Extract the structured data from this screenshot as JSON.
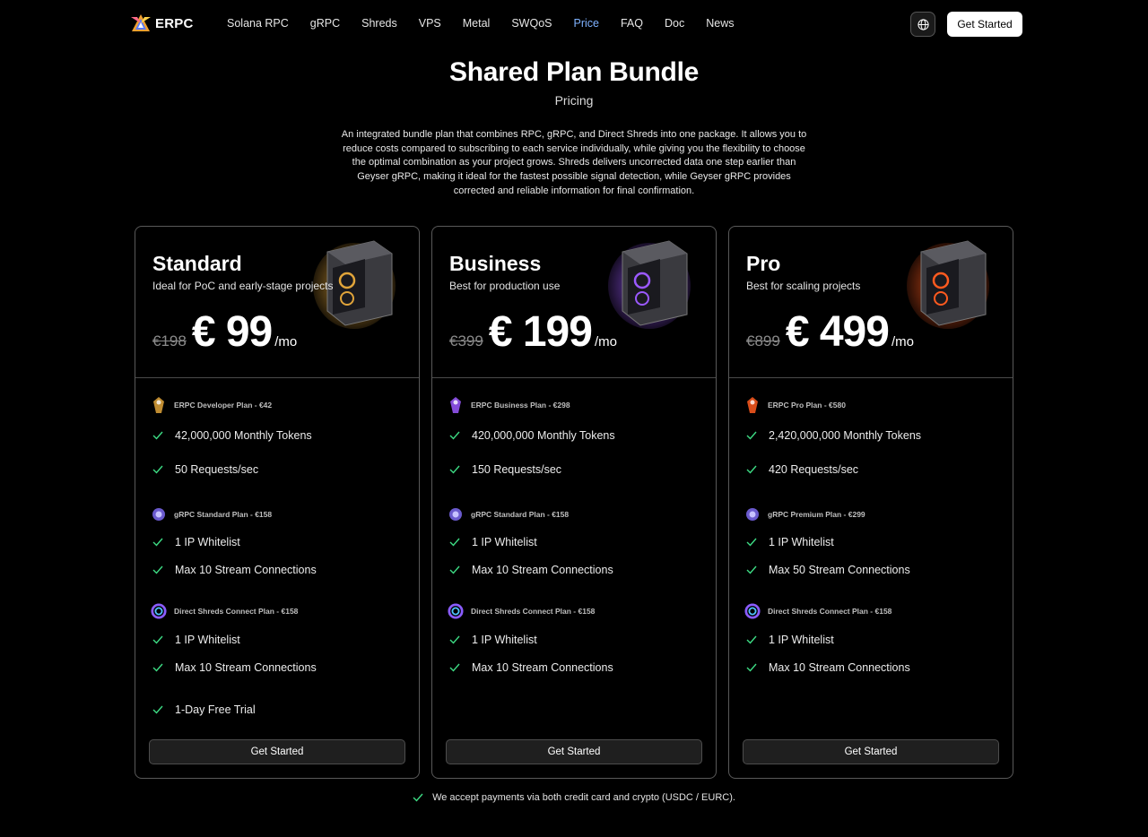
{
  "nav": {
    "logo_text": "ERPC",
    "links": [
      "Solana RPC",
      "gRPC",
      "Shreds",
      "VPS",
      "Metal",
      "SWQoS",
      "Price",
      "FAQ",
      "Doc",
      "News"
    ],
    "active_link": "Price",
    "cta_label": "Get Started",
    "accent_color": "#7fb2ff"
  },
  "hero": {
    "title": "Shared Plan Bundle",
    "subtitle": "Pricing",
    "description": "An integrated bundle plan that combines RPC, gRPC, and Direct Shreds into one package. It allows you to reduce costs compared to subscribing to each service individually, while giving you the flexibility to choose the optimal combination as your project grows. Shreds delivers uncorrected data one step earlier than Geyser gRPC, making it ideal for the fastest possible signal detection, while Geyser gRPC provides corrected and reliable information for final confirmation."
  },
  "plans": [
    {
      "name": "Standard",
      "description": "Ideal for PoC and early-stage projects",
      "old_price": "€198",
      "price": "€ 99",
      "period": "/mo",
      "art_color": "#e0a43a",
      "rpc": {
        "title": "ERPC Developer Plan - €42",
        "features": [
          "42,000,000 Monthly Tokens",
          "50 Requests/sec"
        ]
      },
      "grpc": {
        "title": "gRPC Standard Plan - €158",
        "features": [
          "1 IP Whitelist",
          "Max 10 Stream Connections"
        ]
      },
      "shreds": {
        "title": "Direct Shreds Connect Plan - €158",
        "features": [
          "1 IP Whitelist",
          "Max 10 Stream Connections"
        ]
      },
      "extra": "1-Day Free Trial",
      "cta_label": "Get Started"
    },
    {
      "name": "Business",
      "description": "Best for production use",
      "old_price": "€399",
      "price": "€ 199",
      "period": "/mo",
      "art_color": "#9b59ff",
      "rpc": {
        "title": "ERPC Business Plan - €298",
        "features": [
          "420,000,000 Monthly Tokens",
          "150 Requests/sec"
        ]
      },
      "grpc": {
        "title": "gRPC Standard Plan - €158",
        "features": [
          "1 IP Whitelist",
          "Max 10 Stream Connections"
        ]
      },
      "shreds": {
        "title": "Direct Shreds Connect Plan - €158",
        "features": [
          "1 IP Whitelist",
          "Max 10 Stream Connections"
        ]
      },
      "extra": "",
      "cta_label": "Get Started"
    },
    {
      "name": "Pro",
      "description": "Best for scaling projects",
      "old_price": "€899",
      "price": "€ 499",
      "period": "/mo",
      "art_color": "#ff5a1f",
      "rpc": {
        "title": "ERPC Pro Plan - €580",
        "features": [
          "2,420,000,000 Monthly Tokens",
          "420 Requests/sec"
        ]
      },
      "grpc": {
        "title": "gRPC Premium Plan - €299",
        "features": [
          "1 IP Whitelist",
          "Max 50 Stream Connections"
        ]
      },
      "shreds": {
        "title": "Direct Shreds Connect Plan - €158",
        "features": [
          "1 IP Whitelist",
          "Max 10 Stream Connections"
        ]
      },
      "extra": "",
      "cta_label": "Get Started"
    }
  ],
  "footnote": "We accept payments via both credit card and crypto (USDC / EURC).",
  "colors": {
    "check": "#3ddc84",
    "background": "#000000",
    "card_border": "#595959"
  }
}
